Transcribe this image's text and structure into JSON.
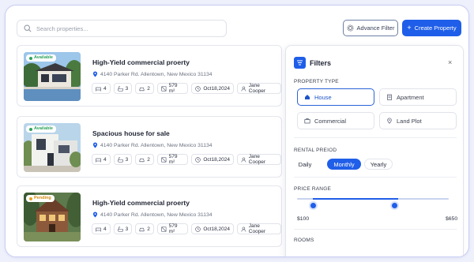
{
  "search": {
    "placeholder": "Search properties..."
  },
  "toolbar": {
    "advance_filter_label": "Advance Filter",
    "create_label": "Create Property"
  },
  "colors": {
    "accent": "#1f5ee8",
    "available": "#2aa35a",
    "pending": "#e8a21f"
  },
  "properties": [
    {
      "status": "Available",
      "title": "High-Yield commercial proerty",
      "address": "4140 Parker Rd. Allentown, New Mexico 31134",
      "beds": "4",
      "baths": "3",
      "garage": "2",
      "area": "579 m²",
      "date": "Oct18,2024",
      "agent": "Jane Cooper"
    },
    {
      "status": "Available",
      "title": "Spacious house for sale",
      "address": "4140 Parker Rd. Allentown, New Mexico 31134",
      "beds": "4",
      "baths": "3",
      "garage": "2",
      "area": "579 m²",
      "date": "Oct18,2024",
      "agent": "Jane Cooper"
    },
    {
      "status": "Pending",
      "title": "High-Yield commercial proerty",
      "address": "4140 Parker Rd. Allentown, New Mexico 31134",
      "beds": "4",
      "baths": "3",
      "garage": "2",
      "area": "579 m²",
      "date": "Oct18,2024",
      "agent": "Jane Cooper"
    }
  ],
  "filters": {
    "title": "Filters",
    "close": "×",
    "property_type_label": "PROPERTY TYPE",
    "types": [
      "House",
      "Apartment",
      "Commercial",
      "Land Plot"
    ],
    "rental_period_label": "RENTAL PREIOD",
    "periods": [
      "Daily",
      "Monthly",
      "Yearly"
    ],
    "price_range_label": "PRICE RANGE",
    "price_min": "$100",
    "price_max": "$650",
    "rooms_label": "ROOMS"
  }
}
